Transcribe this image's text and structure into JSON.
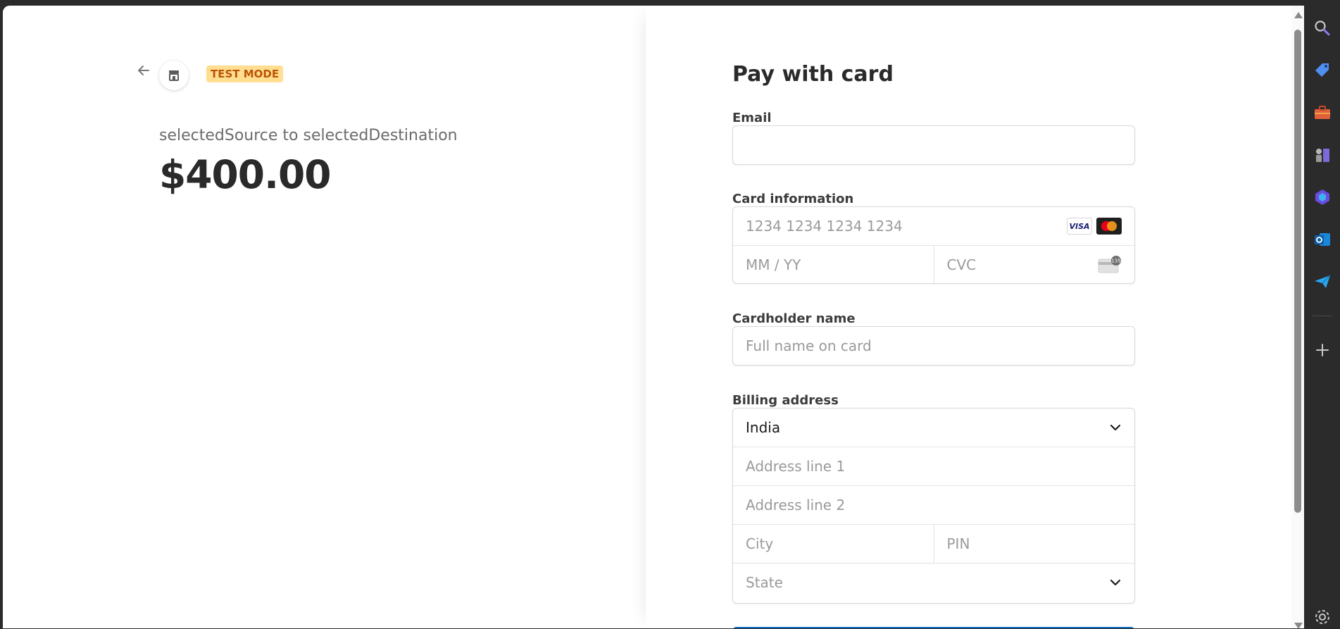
{
  "header": {
    "badge": "TEST MODE"
  },
  "product": {
    "name": "selectedSource to selectedDestination",
    "price": "$400.00"
  },
  "form": {
    "title": "Pay with card",
    "email": {
      "label": "Email",
      "value": "",
      "placeholder": ""
    },
    "card": {
      "label": "Card information",
      "number_placeholder": "1234 1234 1234 1234",
      "expiry_placeholder": "MM / YY",
      "cvc_placeholder": "CVC",
      "brands": [
        "VISA",
        "mastercard"
      ],
      "cvc_icon_text": "135"
    },
    "cardholder": {
      "label": "Cardholder name",
      "placeholder": "Full name on card"
    },
    "billing": {
      "label": "Billing address",
      "country": "India",
      "line1_placeholder": "Address line 1",
      "line2_placeholder": "Address line 2",
      "city_placeholder": "City",
      "pin_placeholder": "PIN",
      "state_placeholder": "State"
    }
  },
  "colors": {
    "badge_bg": "#ffde92",
    "badge_text": "#bb5504",
    "pay_button": "#0a6bbd",
    "page_bg": "#ffffff",
    "chrome_bg": "#2b2b2b"
  },
  "sidebar_icons": [
    "search-icon",
    "tag-icon",
    "toolbox-icon",
    "chess-icon",
    "copilot-icon",
    "outlook-icon",
    "send-icon",
    "add-icon",
    "settings-icon"
  ]
}
